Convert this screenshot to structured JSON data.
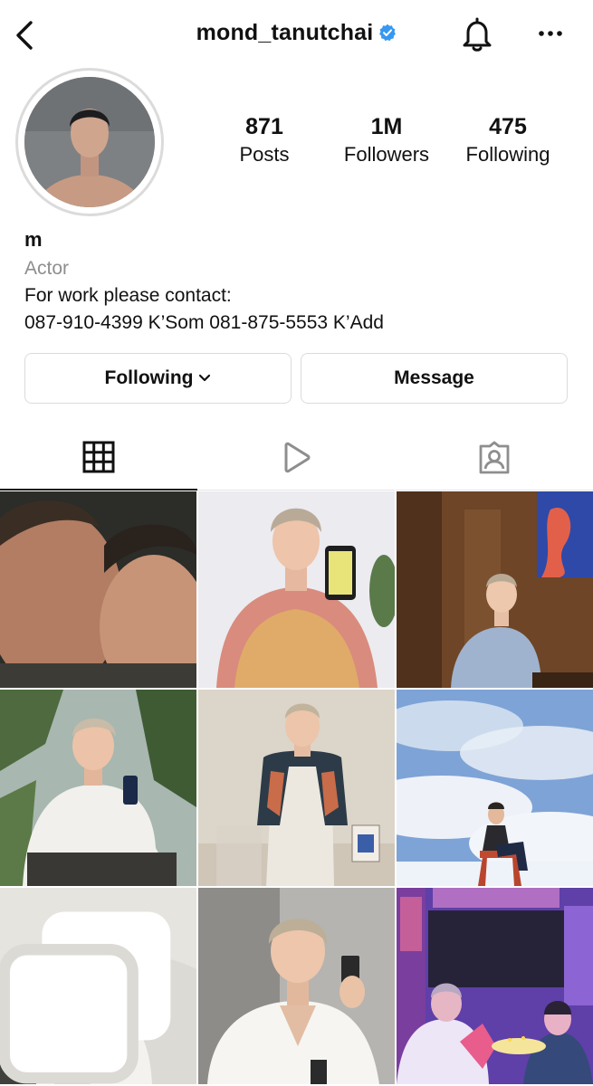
{
  "header": {
    "username": "mond_tanutchai",
    "verified": true,
    "back_icon": "chevron-left-icon",
    "bell_icon": "bell-icon",
    "more_icon": "more-horizontal-icon"
  },
  "stats": {
    "posts": {
      "value": "871",
      "label": "Posts"
    },
    "followers": {
      "value": "1M",
      "label": "Followers"
    },
    "following": {
      "value": "475",
      "label": "Following"
    }
  },
  "bio": {
    "name": "m",
    "category": "Actor",
    "lines": [
      "For work please contact:",
      "087-910-4399 K’Som 081-875-5553 K’Add"
    ]
  },
  "actions": {
    "following_label": "Following",
    "message_label": "Message"
  },
  "tabs": [
    "grid-icon",
    "reels-play-icon",
    "tagged-person-icon"
  ],
  "colors": {
    "verified_blue": "#3897f0",
    "border": "#dbdbdb",
    "secondary_text": "#8e8e8e"
  },
  "posts": [
    {
      "icon": "photo"
    },
    {
      "icon": "photo"
    },
    {
      "icon": "photo"
    },
    {
      "icon": "photo"
    },
    {
      "icon": "photo"
    },
    {
      "icon": "photo"
    },
    {
      "icon": "carousel-icon"
    },
    {
      "icon": "photo"
    },
    {
      "icon": "photo"
    }
  ]
}
